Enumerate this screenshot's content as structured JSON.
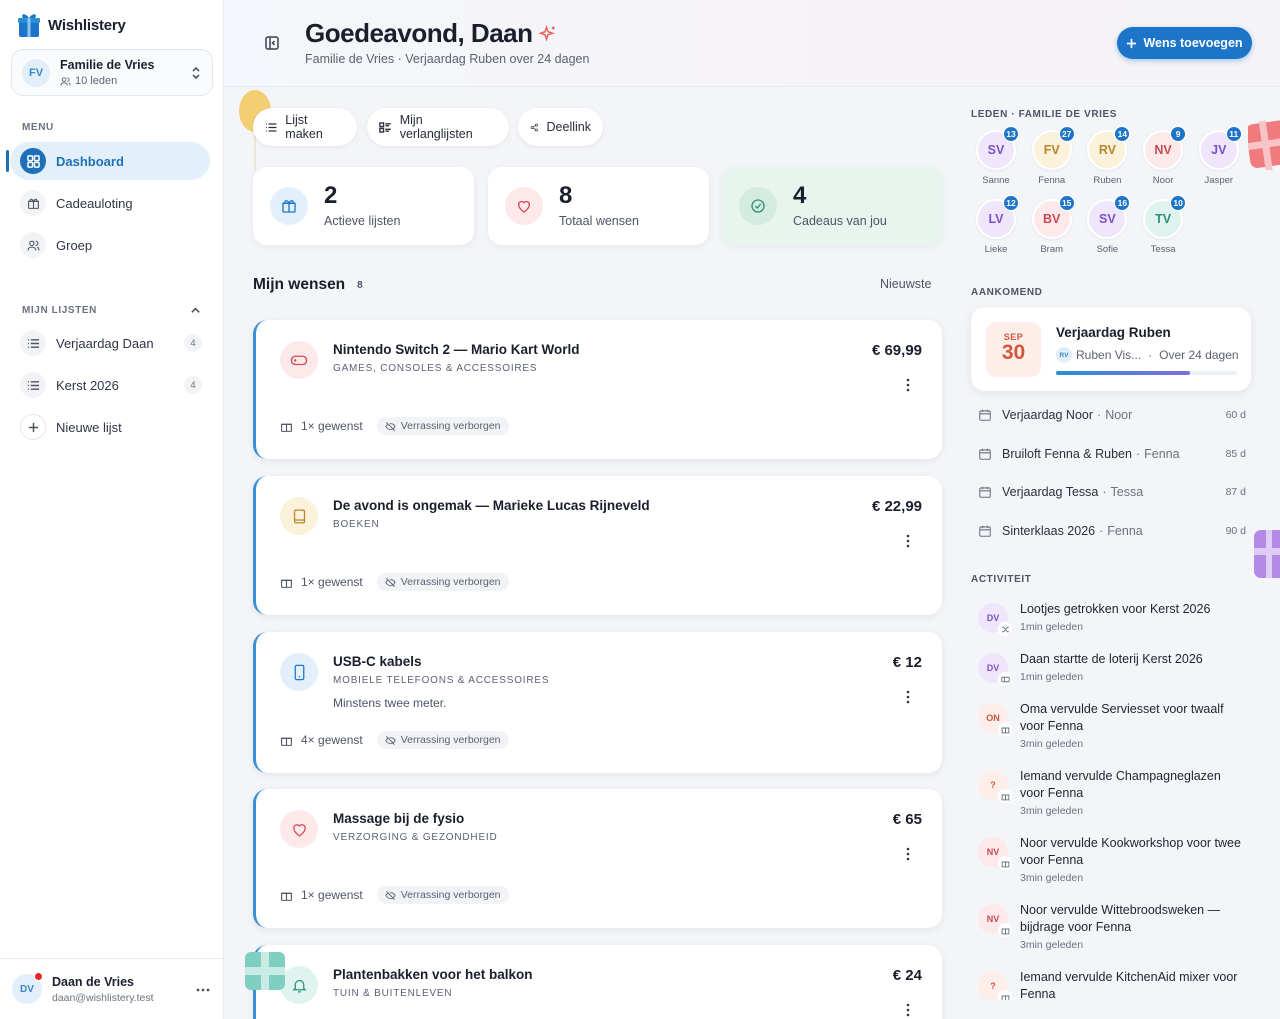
{
  "app": {
    "name": "Wishlistery"
  },
  "family": {
    "initials": "FV",
    "name": "Familie de Vries",
    "members": "10 leden"
  },
  "sidebar": {
    "menu_label": "MENU",
    "items": [
      {
        "label": "Dashboard",
        "icon": "grid-icon",
        "active": true
      },
      {
        "label": "Cadeauloting",
        "icon": "gift-icon"
      },
      {
        "label": "Groep",
        "icon": "users-icon"
      }
    ],
    "lists_label": "MIJN LIJSTEN",
    "lists": [
      {
        "label": "Verjaardag Daan",
        "count": "4"
      },
      {
        "label": "Kerst 2026",
        "count": "4"
      }
    ],
    "new_list": "Nieuwe lijst"
  },
  "user": {
    "initials": "DV",
    "name": "Daan de Vries",
    "email": "daan@wishlistery.test"
  },
  "header": {
    "greeting": "Goedeavond, Daan",
    "subtitle": "Familie de Vries · Verjaardag Ruben over 24 dagen",
    "add_button": "Wens toevoegen"
  },
  "quick_actions": [
    "Lijst maken",
    "Mijn verlanglijsten",
    "Deellink"
  ],
  "stats": [
    {
      "value": "2",
      "label": "Actieve lijsten"
    },
    {
      "value": "8",
      "label": "Totaal wensen"
    },
    {
      "value": "4",
      "label": "Cadeaus van jou"
    }
  ],
  "wishes_section": {
    "title": "Mijn wensen",
    "count": "8",
    "sort": "Nieuwste"
  },
  "wishes": [
    {
      "title": "Nintendo Switch 2 — Mario Kart World",
      "category": "GAMES, CONSOLES & ACCESSOIRES",
      "note": "",
      "price": "€ 69,99",
      "wanted": "1× gewenst",
      "surprise": "Verrassing verborgen",
      "icon": "gamepad-icon"
    },
    {
      "title": "De avond is ongemak — Marieke Lucas Rijneveld",
      "category": "BOEKEN",
      "note": "",
      "price": "€ 22,99",
      "wanted": "1× gewenst",
      "surprise": "Verrassing verborgen",
      "icon": "book-icon"
    },
    {
      "title": "USB-C kabels",
      "category": "MOBIELE TELEFOONS & ACCESSOIRES",
      "note": "Minstens twee meter.",
      "price": "€ 12",
      "wanted": "4× gewenst",
      "surprise": "Verrassing verborgen",
      "icon": "phone-icon"
    },
    {
      "title": "Massage bij de fysio",
      "category": "VERZORGING & GEZONDHEID",
      "note": "",
      "price": "€ 65",
      "wanted": "1× gewenst",
      "surprise": "Verrassing verborgen",
      "icon": "heart-icon"
    },
    {
      "title": "Plantenbakken voor het balkon",
      "category": "TUIN & BUITENLEVEN",
      "note": "",
      "price": "€ 24",
      "wanted": "",
      "surprise": "",
      "icon": "bell-icon"
    }
  ],
  "members_label": "LEDEN · FAMILIE DE VRIES",
  "members": [
    {
      "initials": "SV",
      "name": "Sanne",
      "badge": "13",
      "bg": "#efe6fb",
      "fg": "#7a52c7"
    },
    {
      "initials": "FV",
      "name": "Fenna",
      "badge": "27",
      "bg": "#fbf2dc",
      "fg": "#b8862b"
    },
    {
      "initials": "RV",
      "name": "Ruben",
      "badge": "14",
      "bg": "#fbf2dc",
      "fg": "#b8862b"
    },
    {
      "initials": "NV",
      "name": "Noor",
      "badge": "9",
      "bg": "#fde9ea",
      "fg": "#c84a55"
    },
    {
      "initials": "JV",
      "name": "Jasper",
      "badge": "11",
      "bg": "#efe6fb",
      "fg": "#7a52c7"
    },
    {
      "initials": "LV",
      "name": "Lieke",
      "badge": "12",
      "bg": "#efe6fb",
      "fg": "#7a52c7"
    },
    {
      "initials": "BV",
      "name": "Bram",
      "badge": "15",
      "bg": "#fde9ea",
      "fg": "#c84a55"
    },
    {
      "initials": "SV",
      "name": "Sofie",
      "badge": "16",
      "bg": "#efe6fb",
      "fg": "#7a52c7"
    },
    {
      "initials": "TV",
      "name": "Tessa",
      "badge": "10",
      "bg": "#e0f4ef",
      "fg": "#2e9079"
    }
  ],
  "upcoming_label": "AANKOMEND",
  "upcoming_main": {
    "month": "SEP",
    "day": "30",
    "title": "Verjaardag Ruben",
    "who_initials": "RV",
    "who": "Ruben Vis...",
    "when": "Over 24 dagen",
    "progress": 0.74
  },
  "upcoming": [
    {
      "title": "Verjaardag Noor",
      "who": "Noor",
      "days": "60 d"
    },
    {
      "title": "Bruiloft Fenna & Ruben",
      "who": "Fenna",
      "days": "85 d"
    },
    {
      "title": "Verjaardag Tessa",
      "who": "Tessa",
      "days": "87 d"
    },
    {
      "title": "Sinterklaas 2026",
      "who": "Fenna",
      "days": "90 d"
    }
  ],
  "activity_label": "ACTIVITEIT",
  "activity": [
    {
      "initials": "DV",
      "text": "Lootjes getrokken voor Kerst 2026",
      "time": "1min geleden",
      "bg": "#efe6fb",
      "fg": "#7a52c7"
    },
    {
      "initials": "DV",
      "text": "Daan startte de loterij Kerst 2026",
      "time": "1min geleden",
      "bg": "#efe6fb",
      "fg": "#7a52c7"
    },
    {
      "initials": "ON",
      "text": "Oma vervulde Serviesset voor twaalf voor Fenna",
      "time": "3min geleden",
      "bg": "#fdeeea",
      "fg": "#c8593f"
    },
    {
      "initials": "?",
      "text": "Iemand vervulde Champagneglazen voor Fenna",
      "time": "3min geleden",
      "bg": "#fdeeea",
      "fg": "#c8593f"
    },
    {
      "initials": "NV",
      "text": "Noor vervulde Kookworkshop voor twee voor Fenna",
      "time": "3min geleden",
      "bg": "#fde9ea",
      "fg": "#c84a55"
    },
    {
      "initials": "NV",
      "text": "Noor vervulde Wittebroodsweken — bijdrage voor Fenna",
      "time": "3min geleden",
      "bg": "#fde9ea",
      "fg": "#c84a55"
    },
    {
      "initials": "?",
      "text": "Iemand vervulde KitchenAid mixer voor Fenna",
      "time": "",
      "bg": "#fdeeea",
      "fg": "#c8593f"
    }
  ]
}
